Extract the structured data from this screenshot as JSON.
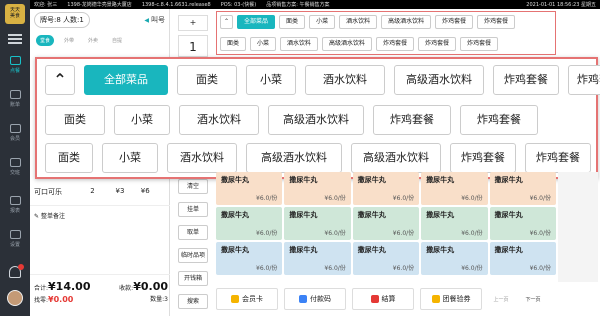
{
  "topbar": {
    "welcome": "欢迎: 张三",
    "store": "1398-龙岗德华亮景路大厦店",
    "version": "1398-c.8.4.1.6631.release8",
    "pos": "POS: 03-(快餐)",
    "plan": "品项销售方案: 午餐销售方案",
    "datetime": "2021-01-01 18:56:23 星期五"
  },
  "sidebar": {
    "logo_text": "天天\n美食",
    "items": [
      {
        "label": "点餐",
        "active": true
      },
      {
        "label": "账单",
        "active": false
      },
      {
        "label": "会员",
        "active": false
      },
      {
        "label": "交班",
        "active": false
      },
      {
        "label": "报表",
        "active": false
      },
      {
        "label": "设置",
        "active": false
      }
    ]
  },
  "order": {
    "table_label": "牌号:8",
    "people_label": "人数:1",
    "call_label": "叫号",
    "tabs": [
      "堂食",
      "外带",
      "外卖",
      "自提"
    ],
    "item": {
      "name": "可口可乐",
      "qty": "2",
      "price": "¥3",
      "total": "¥6"
    },
    "note": "整单备注",
    "total_label": "合计:",
    "total_value": "¥14.00",
    "received_label": "收款:",
    "received_value": "¥0.00",
    "change_label": "找零:",
    "change_value": "¥0.00",
    "count_label": "数量:",
    "count_value": "3"
  },
  "actions": {
    "plus": "+",
    "qty": "1",
    "buttons": [
      "清空",
      "挂单",
      "取单",
      "临时品项",
      "开钱箱",
      "搜索"
    ]
  },
  "categories_small": {
    "row1": [
      "全部菜品",
      "面类",
      "小菜",
      "酒水饮料",
      "高级酒水饮料",
      "炸鸡套餐",
      "炸鸡套餐"
    ],
    "row2": [
      "面类",
      "小菜",
      "酒水饮料",
      "高级酒水饮料",
      "炸鸡套餐",
      "炸鸡套餐",
      "炸鸡套餐"
    ]
  },
  "categories_large": {
    "row1": [
      "全部菜品",
      "面类",
      "小菜",
      "酒水饮料",
      "高级酒水饮料",
      "炸鸡套餐",
      "炸鸡套餐"
    ],
    "row2": [
      "面类",
      "小菜",
      "酒水饮料",
      "高级酒水饮料",
      "炸鸡套餐",
      "炸鸡套餐"
    ],
    "row3": [
      "面类",
      "小菜",
      "酒水饮料",
      "高级酒水饮料",
      "高级酒水饮料",
      "炸鸡套餐",
      "炸鸡套餐"
    ],
    "collapse_icon": "chevron-up-icon"
  },
  "dishes": [
    {
      "name": "撒尿牛丸",
      "price": "¥6.0/份",
      "color": "c0"
    },
    {
      "name": "撒尿牛丸",
      "price": "¥6.0/份",
      "color": "c0"
    },
    {
      "name": "撒尿牛丸",
      "price": "¥6.0/份",
      "color": "c0"
    },
    {
      "name": "撒尿牛丸",
      "price": "¥6.0/份",
      "color": "c0"
    },
    {
      "name": "撒尿牛丸",
      "price": "¥6.0/份",
      "color": "c0"
    },
    {
      "name": "撒尿牛丸",
      "price": "¥6.0/份",
      "color": "c1"
    },
    {
      "name": "撒尿牛丸",
      "price": "¥6.0/份",
      "color": "c1"
    },
    {
      "name": "撒尿牛丸",
      "price": "¥6.0/份",
      "color": "c1"
    },
    {
      "name": "撒尿牛丸",
      "price": "¥6.0/份",
      "color": "c1"
    },
    {
      "name": "撒尿牛丸",
      "price": "¥6.0/份",
      "color": "c1"
    },
    {
      "name": "撒尿牛丸",
      "price": "¥6.0/份",
      "color": "c2"
    },
    {
      "name": "撒尿牛丸",
      "price": "¥6.0/份",
      "color": "c2"
    },
    {
      "name": "撒尿牛丸",
      "price": "¥6.0/份",
      "color": "c2"
    },
    {
      "name": "撒尿牛丸",
      "price": "¥6.0/份",
      "color": "c2"
    },
    {
      "name": "撒尿牛丸",
      "price": "¥6.0/份",
      "color": "c2"
    }
  ],
  "bottom": {
    "buttons": [
      {
        "label": "会员卡",
        "color": "#f5b400"
      },
      {
        "label": "付款码",
        "color": "#3b82f6"
      },
      {
        "label": "结算",
        "color": "#e53935"
      },
      {
        "label": "团餐验券",
        "color": "#f5b400"
      }
    ],
    "prev": "上一页",
    "next": "下一页"
  },
  "colors": {
    "accent": "#19b6be",
    "highlight_border": "#e57373"
  }
}
